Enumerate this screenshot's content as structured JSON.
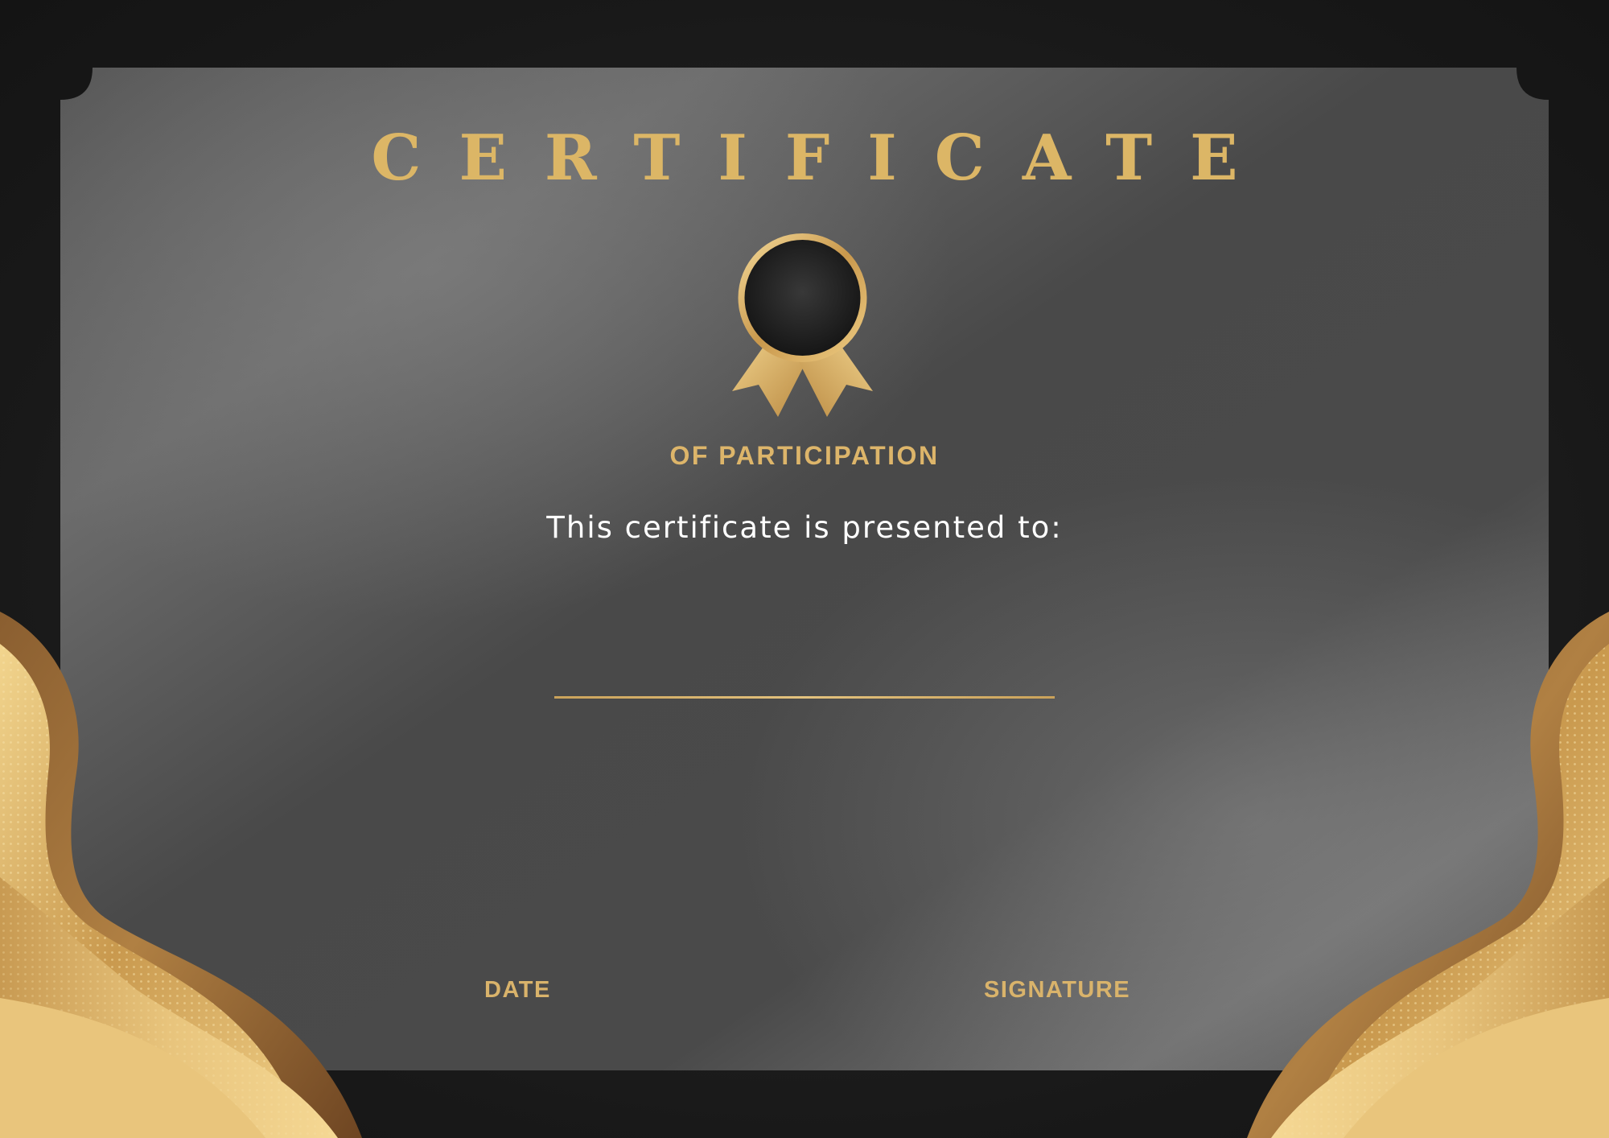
{
  "certificate": {
    "title": "CERTIFICATE",
    "subtitle": "OF PARTICIPATION",
    "presented_text": "This certificate is presented to:",
    "date_label": "DATE",
    "signature_label": "SIGNATURE"
  },
  "colors": {
    "gold": "#dcb666",
    "panel": "#4e4e4e",
    "background": "#1a1a1a",
    "text_white": "#ffffff"
  },
  "decorations": {
    "medal": "medal-icon",
    "corner_waves": "gold-wave-decoration"
  }
}
